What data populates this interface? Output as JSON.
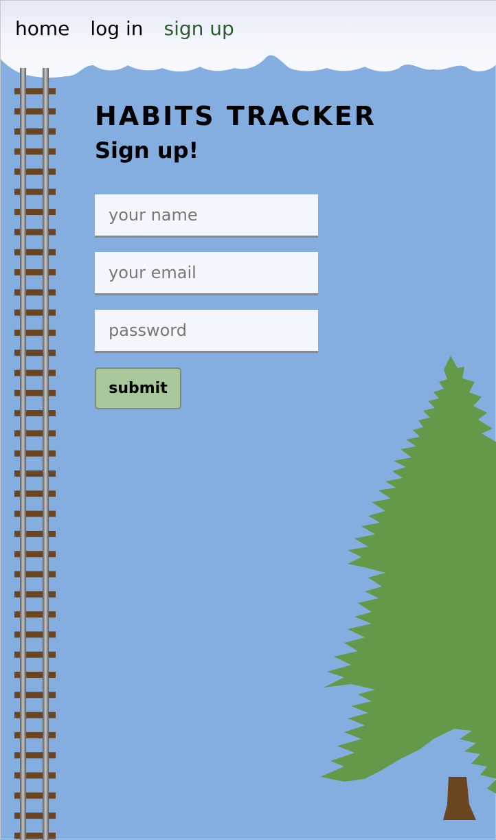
{
  "nav": {
    "home": "home",
    "login": "log in",
    "signup": "sign up"
  },
  "main": {
    "title": "HABITS TRACKER",
    "subtitle": "Sign up!"
  },
  "form": {
    "name_placeholder": "your name",
    "email_placeholder": "your email",
    "password_placeholder": "password",
    "submit_label": "submit"
  },
  "colors": {
    "sky": "#84ade0",
    "active_nav": "#2e5a32",
    "button": "#a8c79b",
    "tree": "#65994a",
    "trunk": "#6b4420",
    "rail_tie": "#6b4420"
  },
  "icons": {
    "header": "cloud-banner",
    "left_decoration": "railway-tracks",
    "right_decoration": "pine-tree"
  }
}
